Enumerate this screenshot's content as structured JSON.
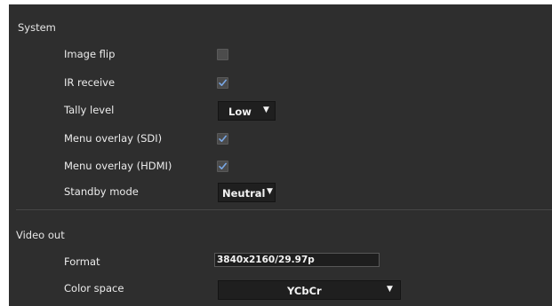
{
  "system": {
    "title": "System",
    "image_flip": {
      "label": "Image flip",
      "checked": false
    },
    "ir_receive": {
      "label": "IR receive",
      "checked": true
    },
    "tally_level": {
      "label": "Tally level",
      "value": "Low",
      "arrow": "▼"
    },
    "menu_overlay_sdi": {
      "label": "Menu overlay (SDI)",
      "checked": true
    },
    "menu_overlay_hdmi": {
      "label": "Menu overlay (HDMI)",
      "checked": true
    },
    "standby_mode": {
      "label": "Standby mode",
      "value": "Neutral",
      "arrow": "▼"
    }
  },
  "video_out": {
    "title": "Video out",
    "format": {
      "label": "Format",
      "value": "3840x2160/29.97p"
    },
    "color_space": {
      "label": "Color space",
      "value": "YCbCr",
      "arrow": "▼"
    }
  },
  "colors": {
    "panel_bg": "#2e2e2e",
    "check_color": "#7aa8e6",
    "text": "#ececec"
  },
  "icons": {
    "check": "check-icon",
    "dropdown": "chevron-down-icon"
  }
}
